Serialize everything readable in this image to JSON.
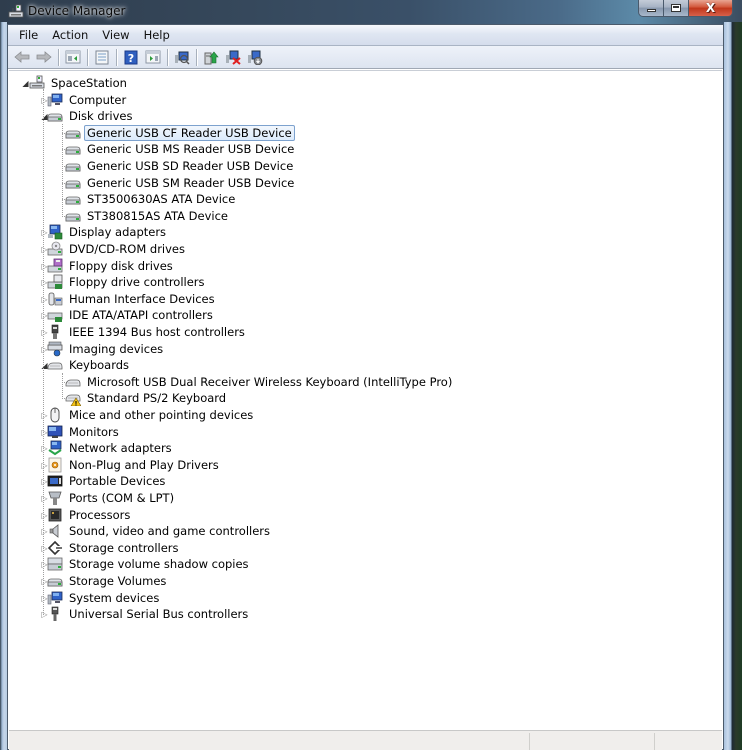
{
  "window": {
    "title": "Device Manager",
    "icon": "device-manager-icon",
    "caption_buttons": [
      {
        "name": "minimize-button",
        "icon": "minimize-icon"
      },
      {
        "name": "maximize-button",
        "icon": "maximize-icon"
      },
      {
        "name": "close-button",
        "icon": "close-icon",
        "glyph": "X"
      }
    ]
  },
  "menu": {
    "items": [
      "File",
      "Action",
      "View",
      "Help"
    ]
  },
  "toolbar": {
    "buttons": [
      {
        "name": "back-button",
        "icon": "arrow-left-icon"
      },
      {
        "name": "forward-button",
        "icon": "arrow-right-icon"
      },
      {
        "name": "show-hide-console-tree-button",
        "icon": "console-tree-icon"
      },
      {
        "name": "properties-button",
        "icon": "properties-icon"
      },
      {
        "name": "help-button",
        "icon": "help-icon"
      },
      {
        "name": "show-hide-action-pane-button",
        "icon": "action-pane-icon"
      },
      {
        "name": "scan-hardware-changes-button",
        "icon": "scan-hardware-icon"
      },
      {
        "name": "update-driver-button",
        "icon": "update-driver-icon"
      },
      {
        "name": "uninstall-button",
        "icon": "uninstall-icon"
      },
      {
        "name": "disable-button",
        "icon": "disable-device-icon"
      }
    ]
  },
  "tree": {
    "root": {
      "label": "SpaceStation",
      "icon": "computer-network-icon",
      "expanded": true
    },
    "categories": [
      {
        "label": "Computer",
        "icon": "computer-icon",
        "expanded": false
      },
      {
        "label": "Disk drives",
        "icon": "disk-drive-icon",
        "expanded": true,
        "children": [
          {
            "label": "Generic USB CF Reader USB Device",
            "icon": "disk-drive-icon",
            "selected": true
          },
          {
            "label": "Generic USB MS Reader USB Device",
            "icon": "disk-drive-icon"
          },
          {
            "label": "Generic USB SD Reader USB Device",
            "icon": "disk-drive-icon"
          },
          {
            "label": "Generic USB SM Reader USB Device",
            "icon": "disk-drive-icon"
          },
          {
            "label": "ST3500630AS ATA Device",
            "icon": "disk-drive-icon"
          },
          {
            "label": "ST380815AS ATA Device",
            "icon": "disk-drive-icon"
          }
        ]
      },
      {
        "label": "Display adapters",
        "icon": "display-adapter-icon",
        "expanded": false
      },
      {
        "label": "DVD/CD-ROM drives",
        "icon": "dvd-drive-icon",
        "expanded": false
      },
      {
        "label": "Floppy disk drives",
        "icon": "floppy-drive-icon",
        "expanded": false
      },
      {
        "label": "Floppy drive controllers",
        "icon": "floppy-controller-icon",
        "expanded": false
      },
      {
        "label": "Human Interface Devices",
        "icon": "hid-icon",
        "expanded": false
      },
      {
        "label": "IDE ATA/ATAPI controllers",
        "icon": "ide-controller-icon",
        "expanded": false
      },
      {
        "label": "IEEE 1394 Bus host controllers",
        "icon": "ieee1394-icon",
        "expanded": false
      },
      {
        "label": "Imaging devices",
        "icon": "imaging-device-icon",
        "expanded": false
      },
      {
        "label": "Keyboards",
        "icon": "keyboard-icon",
        "expanded": true,
        "children": [
          {
            "label": "Microsoft USB Dual Receiver Wireless Keyboard (IntelliType Pro)",
            "icon": "keyboard-icon"
          },
          {
            "label": "Standard PS/2 Keyboard",
            "icon": "keyboard-warning-icon",
            "warning": true
          }
        ]
      },
      {
        "label": "Mice and other pointing devices",
        "icon": "mouse-icon",
        "expanded": false
      },
      {
        "label": "Monitors",
        "icon": "monitor-icon",
        "expanded": false
      },
      {
        "label": "Network adapters",
        "icon": "network-adapter-icon",
        "expanded": false
      },
      {
        "label": "Non-Plug and Play Drivers",
        "icon": "non-pnp-driver-icon",
        "expanded": false
      },
      {
        "label": "Portable Devices",
        "icon": "portable-device-icon",
        "expanded": false
      },
      {
        "label": "Ports (COM & LPT)",
        "icon": "port-icon",
        "expanded": false
      },
      {
        "label": "Processors",
        "icon": "processor-icon",
        "expanded": false
      },
      {
        "label": "Sound, video and game controllers",
        "icon": "speaker-icon",
        "expanded": false
      },
      {
        "label": "Storage controllers",
        "icon": "storage-controller-icon",
        "expanded": false
      },
      {
        "label": "Storage volume shadow copies",
        "icon": "shadow-copy-icon",
        "expanded": false
      },
      {
        "label": "Storage Volumes",
        "icon": "storage-volume-icon",
        "expanded": false
      },
      {
        "label": "System devices",
        "icon": "system-device-icon",
        "expanded": false
      },
      {
        "label": "Universal Serial Bus controllers",
        "icon": "usb-icon",
        "expanded": false
      }
    ]
  },
  "statusbar": {
    "panes": [
      "",
      "",
      ""
    ]
  },
  "colors": {
    "selection_border": "#7da2ce",
    "selection_fill": "#dcebfc",
    "close_button": "#c8452a",
    "menubar": "#dfe6f2"
  }
}
